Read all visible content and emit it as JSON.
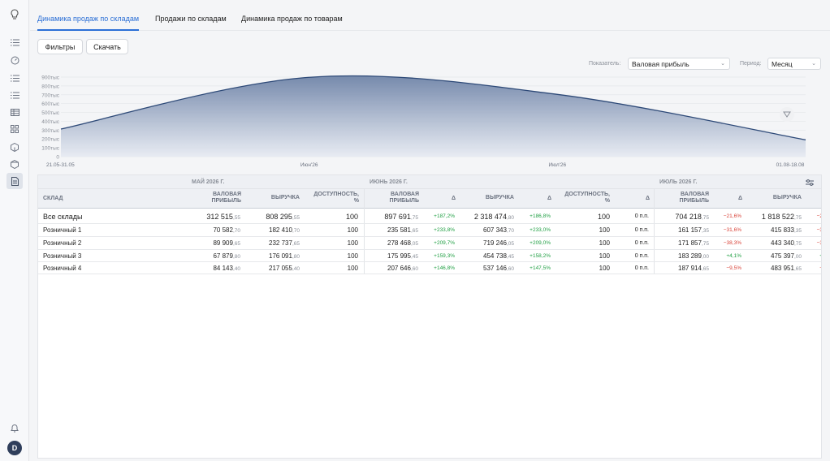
{
  "tabs": [
    {
      "label": "Динамика продаж по складам",
      "active": true
    },
    {
      "label": "Продажи по складам",
      "active": false
    },
    {
      "label": "Динамика продаж по товарам",
      "active": false
    }
  ],
  "toolbar": {
    "filters_label": "Фильтры",
    "download_label": "Скачать"
  },
  "controls": {
    "indicator_label": "Показатель:",
    "indicator_value": "Валовая прибыль",
    "period_label": "Период:",
    "period_value": "Месяц"
  },
  "chart_data": {
    "type": "area",
    "y_ticks": [
      "900тыс",
      "800тыс",
      "700тыс",
      "600тыс",
      "500тыс",
      "400тыс",
      "300тыс",
      "200тыс",
      "100тыс",
      "0"
    ],
    "x_ticks": [
      "21.05-31.05",
      "Июн'26",
      "Июл'26",
      "01.08-18.08"
    ],
    "ylim": [
      0,
      900000
    ],
    "x": [
      "21.05-31.05",
      "Июн'26",
      "Июл'26",
      "01.08-18.08"
    ],
    "values": [
      312515,
      897691,
      704218,
      190000
    ],
    "grid": true,
    "colors": {
      "line": "#2e4a78",
      "fill_top": "#6f84a8",
      "fill_bottom": "#e6eaf2"
    }
  },
  "table": {
    "groups": [
      "МАЙ 2026 Г.",
      "ИЮНЬ 2026 Г.",
      "ИЮЛЬ 2026 Г."
    ],
    "headers": {
      "warehouse": "СКЛАД",
      "gross1": "ВАЛОВАЯ",
      "gross2": "ПРИБЫЛЬ",
      "revenue": "ВЫРУЧКА",
      "avail1": "ДОСТУПНОСТЬ,",
      "avail2": "%",
      "delta": "Δ"
    },
    "rows": [
      {
        "name": "Все склады",
        "may_gross_int": "312 515",
        "may_gross_dec": ",55",
        "may_rev_int": "808 295",
        "may_rev_dec": ",55",
        "may_avail": "100",
        "jun_gross_int": "897 691",
        "jun_gross_dec": ",75",
        "jun_gross_d": "+187,2%",
        "jun_rev_int": "2 318 474",
        "jun_rev_dec": ",80",
        "jun_rev_d": "+186,8%",
        "jun_avail": "100",
        "jun_avail_d": "0 п.п.",
        "jul_gross_int": "704 218",
        "jul_gross_dec": ",75",
        "jul_gross_d": "−21,6%",
        "jul_rev_int": "1 818 522",
        "jul_rev_dec": ",75",
        "jul_rev_d": "−2"
      },
      {
        "name": "Розничный 1",
        "may_gross_int": "70 582",
        "may_gross_dec": ",70",
        "may_rev_int": "182 410",
        "may_rev_dec": ",70",
        "may_avail": "100",
        "jun_gross_int": "235 581",
        "jun_gross_dec": ",65",
        "jun_gross_d": "+233,8%",
        "jun_rev_int": "607 343",
        "jun_rev_dec": ",70",
        "jun_rev_d": "+233,0%",
        "jun_avail": "100",
        "jun_avail_d": "0 п.п.",
        "jul_gross_int": "161 157",
        "jul_gross_dec": ",35",
        "jul_gross_d": "−31,6%",
        "jul_rev_int": "415 833",
        "jul_rev_dec": ",35",
        "jul_rev_d": "−3"
      },
      {
        "name": "Розничный 2",
        "may_gross_int": "89 909",
        "may_gross_dec": ",65",
        "may_rev_int": "232 737",
        "may_rev_dec": ",65",
        "may_avail": "100",
        "jun_gross_int": "278 468",
        "jun_gross_dec": ",05",
        "jun_gross_d": "+209,7%",
        "jun_rev_int": "719 246",
        "jun_rev_dec": ",05",
        "jun_rev_d": "+209,0%",
        "jun_avail": "100",
        "jun_avail_d": "0 п.п.",
        "jul_gross_int": "171 857",
        "jul_gross_dec": ",75",
        "jul_gross_d": "−38,3%",
        "jul_rev_int": "443 340",
        "jul_rev_dec": ",75",
        "jul_rev_d": "−3"
      },
      {
        "name": "Розничный 3",
        "may_gross_int": "67 879",
        "may_gross_dec": ",80",
        "may_rev_int": "176 091",
        "may_rev_dec": ",80",
        "may_avail": "100",
        "jun_gross_int": "175 995",
        "jun_gross_dec": ",45",
        "jun_gross_d": "+159,3%",
        "jun_rev_int": "454 738",
        "jun_rev_dec": ",45",
        "jun_rev_d": "+158,2%",
        "jun_avail": "100",
        "jun_avail_d": "0 п.п.",
        "jul_gross_int": "183 289",
        "jul_gross_dec": ",00",
        "jul_gross_d": "+4,1%",
        "jul_rev_int": "475 397",
        "jul_rev_dec": ",00",
        "jul_rev_d": "+"
      },
      {
        "name": "Розничный 4",
        "may_gross_int": "84 143",
        "may_gross_dec": ",40",
        "may_rev_int": "217 055",
        "may_rev_dec": ",40",
        "may_avail": "100",
        "jun_gross_int": "207 646",
        "jun_gross_dec": ",60",
        "jun_gross_d": "+146,8%",
        "jun_rev_int": "537 146",
        "jun_rev_dec": ",60",
        "jun_rev_d": "+147,5%",
        "jun_avail": "100",
        "jun_avail_d": "0 п.п.",
        "jul_gross_int": "187 914",
        "jul_gross_dec": ",65",
        "jul_gross_d": "−9,5%",
        "jul_rev_int": "483 951",
        "jul_rev_dec": ",65",
        "jul_rev_d": "−"
      }
    ]
  },
  "user": {
    "avatar_initial": "D"
  }
}
